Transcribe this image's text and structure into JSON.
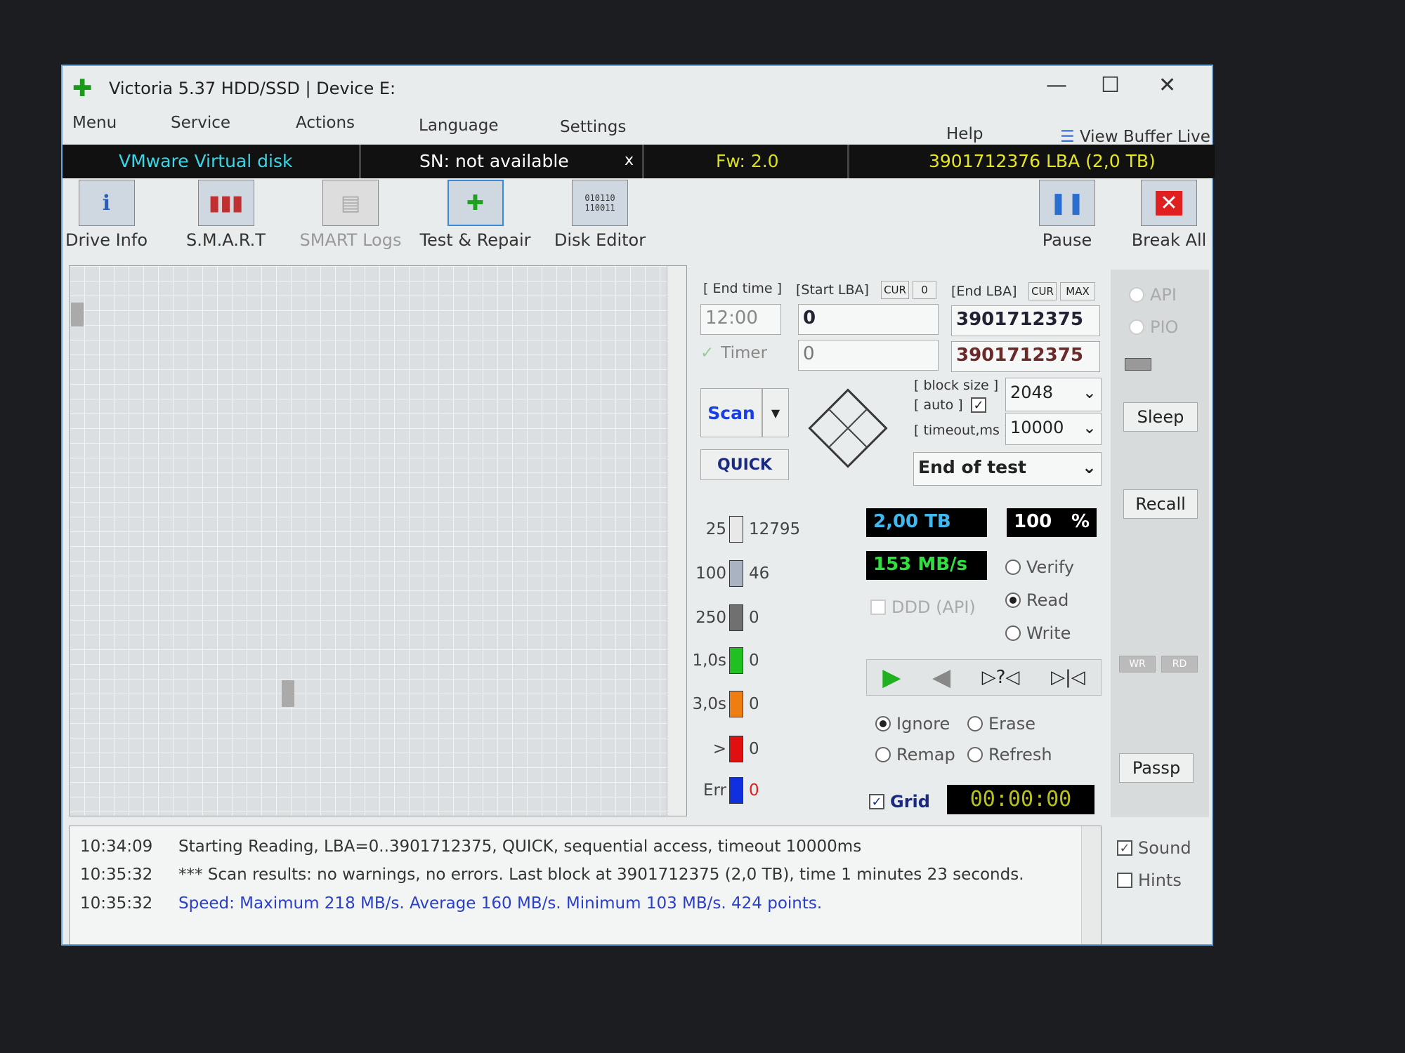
{
  "window": {
    "title": "Victoria 5.37 HDD/SSD | Device E:",
    "minimize": "—",
    "maximize": "☐",
    "close": "✕"
  },
  "menu": [
    "Menu",
    "Service",
    "Actions",
    "Language",
    "Settings",
    "Help"
  ],
  "view_buffer": "View Buffer Live",
  "info": {
    "model": "VMware  Virtual disk",
    "sn": "SN: not available",
    "sn_close": "x",
    "fw": "Fw: 2.0",
    "lba": "3901712376 LBA (2,0 TB)"
  },
  "toolbar": [
    "Drive Info",
    "S.M.A.R.T",
    "SMART Logs",
    "Test & Repair",
    "Disk Editor"
  ],
  "pause": "Pause",
  "break_all": "Break All",
  "controls": {
    "end_time_label": "[ End time ]",
    "start_lba_label": "[Start LBA]",
    "cur": "CUR",
    "zero": "0",
    "end_lba_label": "[End LBA]",
    "max": "MAX",
    "end_time": "12:00",
    "start_lba": "0",
    "end_lba": "3901712375",
    "timer": "Timer",
    "start_lba2": "0",
    "end_lba2": "3901712375",
    "scan": "Scan",
    "quick": "QUICK",
    "block_size_label": "[ block size ]",
    "auto_label": "[ auto ]",
    "block_size": "2048",
    "timeout_label": "[ timeout,ms ]",
    "timeout": "10000",
    "end_action": "End of test"
  },
  "stats": [
    {
      "label": "25",
      "count": "12795",
      "color": "#e8e8e8"
    },
    {
      "label": "100",
      "count": "46",
      "color": "#a9b3c2"
    },
    {
      "label": "250",
      "count": "0",
      "color": "#707070"
    },
    {
      "label": "1,0s",
      "count": "0",
      "color": "#20c020"
    },
    {
      "label": "3,0s",
      "count": "0",
      "color": "#f07d10"
    },
    {
      "label": ">",
      "count": "0",
      "color": "#e01010"
    },
    {
      "label": "Err",
      "count": "0",
      "color": "#1030e0"
    }
  ],
  "readout": {
    "size": "2,00 TB",
    "percent": "100",
    "pct_sign": "%",
    "speed": "153 MB/s"
  },
  "ddd": "DDD (API)",
  "modes": [
    "Verify",
    "Read",
    "Write"
  ],
  "mode_selected": "Read",
  "actions": [
    "Ignore",
    "Erase",
    "Remap",
    "Refresh"
  ],
  "action_selected": "Ignore",
  "grid_label": "Grid",
  "timer_display": "00:00:00",
  "side": {
    "api": "API",
    "pio": "PIO",
    "sleep": "Sleep",
    "recall": "Recall",
    "wr": "WR",
    "rd": "RD",
    "passp": "Passp",
    "sound": "Sound",
    "hints": "Hints"
  },
  "log": [
    {
      "time": "10:34:09",
      "msg": "Starting Reading, LBA=0..3901712375, QUICK, sequential access, timeout 10000ms",
      "color": "#333333"
    },
    {
      "time": "10:35:32",
      "msg": "*** Scan results: no warnings, no errors. Last block at 3901712375 (2,0 TB), time 1 minutes 23 seconds.",
      "color": "#333333"
    },
    {
      "time": "10:35:32",
      "msg": "Speed: Maximum 218 MB/s. Average 160 MB/s. Minimum 103 MB/s. 424 points.",
      "color": "#2a3fc8"
    }
  ]
}
